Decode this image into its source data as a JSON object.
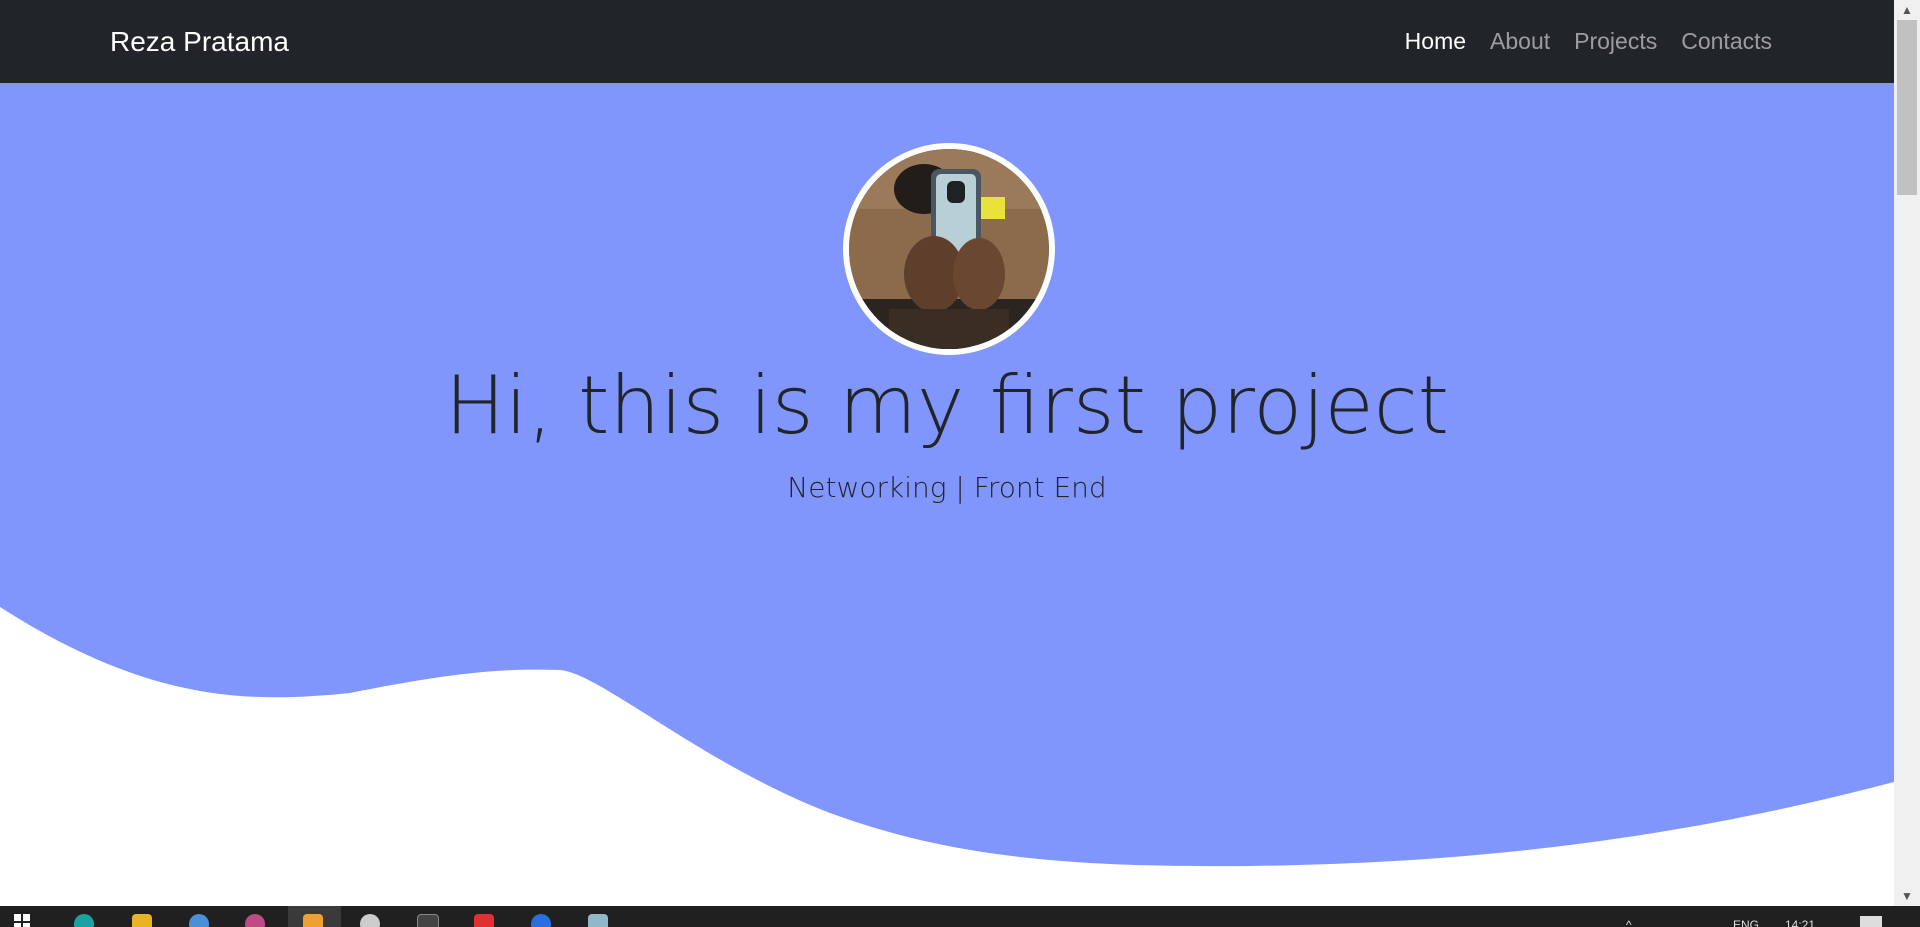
{
  "navbar": {
    "brand": "Reza Pratama",
    "links": [
      {
        "label": "Home",
        "active": true
      },
      {
        "label": "About",
        "active": false
      },
      {
        "label": "Projects",
        "active": false
      },
      {
        "label": "Contacts",
        "active": false
      }
    ]
  },
  "hero": {
    "title": "Hi, this is my first project",
    "subtitle": "Networking | Front End",
    "background_color": "#8096fc",
    "text_color": "#212529"
  },
  "taskbar": {
    "icons": [
      "windows-start-icon",
      "edge-browser-icon",
      "file-explorer-icon",
      "app-icon",
      "app-icon",
      "app-icon",
      "settings-icon",
      "terminal-icon",
      "app-icon",
      "app-icon",
      "app-icon"
    ],
    "tray": {
      "language": "ENG",
      "time": "14:21"
    }
  }
}
